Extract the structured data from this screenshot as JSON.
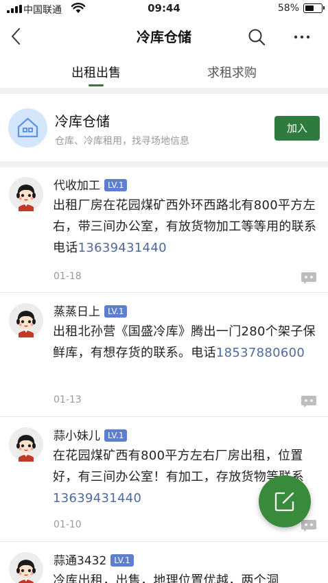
{
  "status_bar": {
    "carrier": "中国联通",
    "time": "09:44",
    "battery_pct": "58%",
    "battery_level": 0.58
  },
  "nav": {
    "title": "冷库仓储"
  },
  "tabs": [
    {
      "label": "出租出售"
    },
    {
      "label": "求租求购"
    }
  ],
  "group": {
    "name": "冷库仓储",
    "desc": "仓库、冷库租用，找寻场地信息",
    "join_label": "加入"
  },
  "posts": [
    {
      "user": "代收加工",
      "level": "LV.1",
      "text": "出租厂房在花园煤矿西外环西路北有800平方左右，带三间办公室，有放货物加工等等用的联系电话",
      "phone": "13639431440",
      "date": "01-18"
    },
    {
      "user": "蒸蒸日上",
      "level": "LV.1",
      "text": "出租北孙营《国盛冷库》腾出一门280个架子保鲜库，有想存货的联系。电话",
      "phone": "18537880600",
      "date": "01-13"
    },
    {
      "user": "蒜小妹儿",
      "level": "LV.1",
      "text": "在花园煤矿西有800平方左右厂房出租，位置好，有三间办公室！有加工，存放货物等联系",
      "phone": "13639431440",
      "date": "01-10"
    },
    {
      "user": "蒜通3432",
      "level": "LV.1",
      "text": "冷库出租，出售，地理位置优越，两个洞",
      "phone": "",
      "date": ""
    }
  ],
  "colors": {
    "brand_green": "#2f7a3e",
    "fab_green": "#3a8a3c",
    "level_badge": "#5e7fd0",
    "phone_link": "#4e6a9c"
  }
}
